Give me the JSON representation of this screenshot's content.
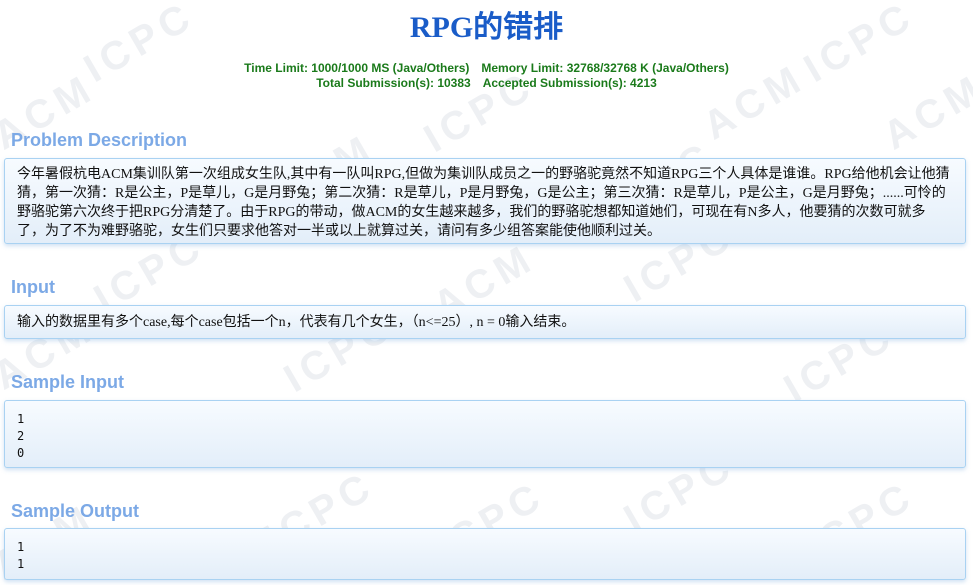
{
  "problem": {
    "title": "RPG的错排",
    "time_limit": "Time Limit: 1000/1000 MS (Java/Others)",
    "memory_limit": "Memory Limit: 32768/32768 K (Java/Others)",
    "total_submissions": "Total Submission(s): 10383",
    "accepted_submissions": "Accepted Submission(s): 4213"
  },
  "sections": {
    "description": {
      "heading": "Problem Description",
      "text": "今年暑假杭电ACM集训队第一次组成女生队,其中有一队叫RPG,但做为集训队成员之一的野骆驼竟然不知道RPG三个人具体是谁谁。RPG给他机会让他猜猜，第一次猜：R是公主，P是草儿，G是月野兔；第二次猜：R是草儿，P是月野兔，G是公主；第三次猜：R是草儿，P是公主，G是月野兔；......可怜的野骆驼第六次终于把RPG分清楚了。由于RPG的带动，做ACM的女生越来越多，我们的野骆驼想都知道她们，可现在有N多人，他要猜的次数可就多了，为了不为难野骆驼，女生们只要求他答对一半或以上就算过关，请问有多少组答案能使他顺利过关。"
    },
    "input": {
      "heading": "Input",
      "text": "输入的数据里有多个case,每个case包括一个n，代表有几个女生，（n<=25）, n = 0输入结束。"
    },
    "sample_input": {
      "heading": "Sample Input",
      "text": "1\n2\n0"
    },
    "sample_output": {
      "heading": "Sample Output",
      "text": "1\n1"
    }
  },
  "watermark": "ACM ICPC"
}
